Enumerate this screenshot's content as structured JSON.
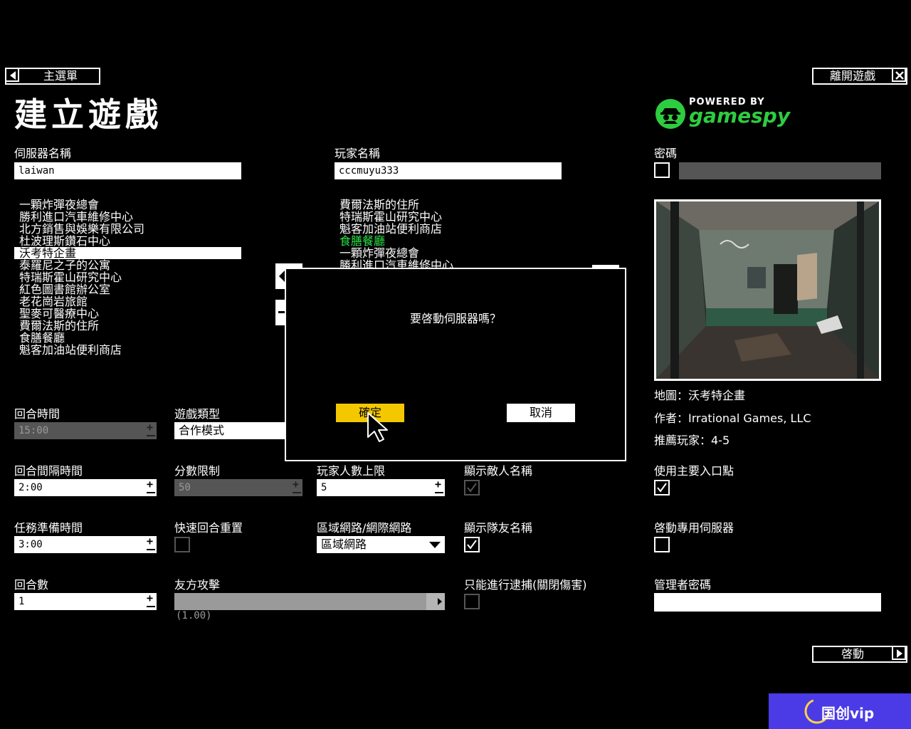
{
  "nav": {
    "main_menu": "主選單",
    "exit_game": "離開遊戲",
    "start": "啓動"
  },
  "page_title": "建立遊戲",
  "logo": {
    "powered_by": "POWERED BY",
    "brand": "gamespy"
  },
  "server_name": {
    "label": "伺服器名稱",
    "value": "laiwan"
  },
  "player_name": {
    "label": "玩家名稱",
    "value": "cccmuyu333"
  },
  "password": {
    "label": "密碼",
    "checked": false,
    "value": ""
  },
  "map_list_left": [
    "一顆炸彈夜總會",
    "勝利進口汽車維修中心",
    "北方銷售與娛樂有限公司",
    "杜波理斯鑽石中心",
    "沃考特企畫",
    "泰羅尼之子的公寓",
    "特瑞斯霍山研究中心",
    "紅色圖書館辦公室",
    "老花崗岩旅館",
    "聖麥可醫療中心",
    "費爾法斯的住所",
    "食膳餐廳",
    "魁客加油站便利商店"
  ],
  "map_list_left_selected": 4,
  "map_list_right": [
    "費爾法斯的住所",
    "特瑞斯霍山研究中心",
    "魁客加油站便利商店",
    "食膳餐廳",
    "一顆炸彈夜總會",
    "勝利進口汽車維修中心"
  ],
  "map_list_right_highlight": 3,
  "map_info": {
    "map": "地圖：沃考特企畫",
    "author": "作者：Irrational Games, LLC",
    "players": "推薦玩家：4-5"
  },
  "settings": {
    "round_time": {
      "label": "回合時間",
      "value": "15:00"
    },
    "game_type": {
      "label": "遊戲類型",
      "value": "合作模式"
    },
    "round_interval": {
      "label": "回合間隔時間",
      "value": "2:00"
    },
    "score_limit": {
      "label": "分數限制",
      "value": "50"
    },
    "max_players": {
      "label": "玩家人數上限",
      "value": "5"
    },
    "show_enemy_names": {
      "label": "顯示敵人名稱",
      "checked": true
    },
    "use_main_entry": {
      "label": "使用主要入口點",
      "checked": true
    },
    "mission_prep": {
      "label": "任務準備時間",
      "value": "3:00"
    },
    "quick_reset": {
      "label": "快速回合重置",
      "checked": false
    },
    "network": {
      "label": "區域網路/網際網路",
      "value": "區域網路"
    },
    "show_team_names": {
      "label": "顯示隊友名稱",
      "checked": true
    },
    "dedicated_server": {
      "label": "啓動專用伺服器",
      "checked": false
    },
    "rounds": {
      "label": "回合數",
      "value": "1"
    },
    "friendly_fire": {
      "label": "友方攻擊",
      "value_text": "(1.00)",
      "value": 1.0
    },
    "arrest_only": {
      "label": "只能進行逮捕(關閉傷害)",
      "checked": false
    },
    "admin_password": {
      "label": "管理者密碼",
      "value": ""
    }
  },
  "dialog": {
    "message": "要啓動伺服器嗎？",
    "ok": "確定",
    "cancel": "取消"
  },
  "watermark": {
    "text": "国创vip"
  },
  "colors": {
    "accent_yellow": "#f4c800",
    "highlight_green": "#2ee04a",
    "watermark_bg": "#4b3be6"
  }
}
